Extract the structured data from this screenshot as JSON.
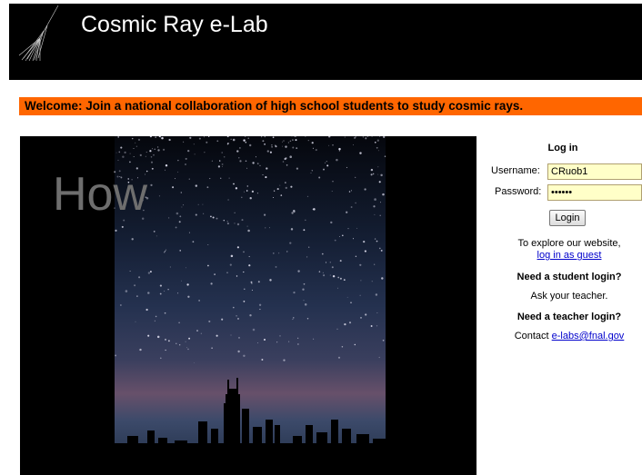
{
  "header": {
    "title": "Cosmic Ray e-Lab"
  },
  "welcome": {
    "text": "Welcome: Join a national collaboration of high school students to study cosmic rays."
  },
  "video": {
    "overlay_text": "How"
  },
  "login": {
    "heading": "Log in",
    "username_label": "Username:",
    "username_value": "CRuob1",
    "password_label": "Password:",
    "password_value": "••••••",
    "button_label": "Login",
    "explore_text": "To explore our website,",
    "guest_link": "log in as guest",
    "student_heading": "Need a student login?",
    "student_text": "Ask your teacher.",
    "teacher_heading": "Need a teacher login?",
    "teacher_prefix": "Contact ",
    "teacher_email": "e-labs@fnal.gov"
  },
  "colors": {
    "header_bg": "#000000",
    "welcome_bg": "#ff6600",
    "input_bg": "#ffffc8",
    "link": "#0000cc"
  }
}
